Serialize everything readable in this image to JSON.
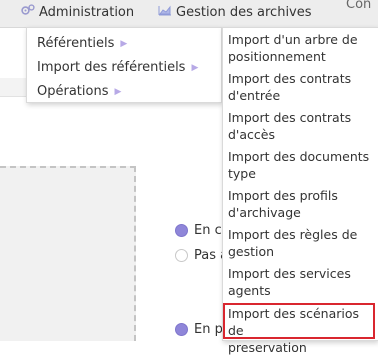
{
  "topbar": {
    "administration_label": "Administration",
    "gestion_label": "Gestion des archives",
    "cut_text": "Con"
  },
  "background": {
    "radios": [
      {
        "label": "En co",
        "selected": true
      },
      {
        "label": "Pas a",
        "selected": false
      },
      {
        "label": "En p",
        "selected": true
      }
    ]
  },
  "menu": {
    "level1": [
      {
        "label": "Référentiels",
        "has_submenu": true
      },
      {
        "label": "Import des référentiels",
        "has_submenu": true
      },
      {
        "label": "Opérations",
        "has_submenu": true
      }
    ],
    "level2": [
      {
        "lines": [
          "Import d'un arbre de",
          "positionnement"
        ]
      },
      {
        "lines": [
          "Import des contrats",
          "d'entrée"
        ]
      },
      {
        "lines": [
          "Import des contrats",
          "d'accès"
        ]
      },
      {
        "lines": [
          "Import des documents",
          "type"
        ]
      },
      {
        "lines": [
          "Import des profils",
          "d'archivage"
        ]
      },
      {
        "lines": [
          "Import des règles de",
          "gestion"
        ]
      },
      {
        "lines": [
          "Import des services",
          "agents"
        ]
      },
      {
        "lines": [
          "Import des scénarios de",
          "preservation"
        ],
        "highlighted": true
      }
    ]
  },
  "colors": {
    "highlight_border": "#d9262f",
    "radio_selected": "#8f86d9",
    "chevron": "#b7a9e6"
  },
  "icons": {
    "administration": "gears-icon",
    "gestion": "chart-icon",
    "submenu": "chevron-right-icon"
  }
}
